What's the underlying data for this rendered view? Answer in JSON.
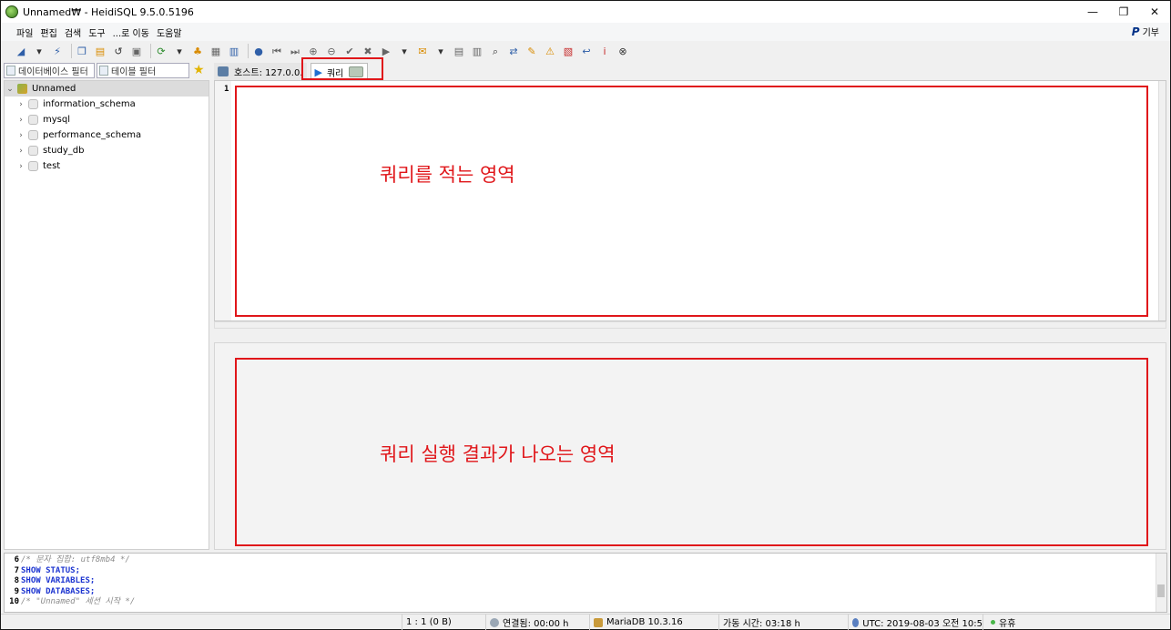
{
  "window": {
    "title": "Unnamed₩ - HeidiSQL 9.5.0.5196",
    "controls": [
      "—",
      "❐",
      "✕"
    ]
  },
  "menu": {
    "items": [
      "파일",
      "편집",
      "검색",
      "도구",
      "...로 이동",
      "도움말"
    ],
    "donate_label": "기부",
    "donate_logo": "P"
  },
  "toolbar": {
    "icons": [
      "connect-icon",
      "dropdown-icon",
      "disconnect-icon",
      "copy-icon",
      "paste-icon",
      "undo-icon",
      "print-icon",
      "refresh-icon",
      "dropdown-icon",
      "user-manager-icon",
      "export-icon",
      "import-icon",
      "help-icon",
      "first-icon",
      "last-icon",
      "add-icon",
      "remove-icon",
      "apply-icon",
      "cancel-icon",
      "run-icon",
      "dropdown-icon",
      "snippet-icon",
      "dropdown-icon",
      "save-icon",
      "save-as-icon",
      "find-icon",
      "replace-icon",
      "edit-icon",
      "warning-icon",
      "sql-icon",
      "wrap-icon",
      "info-icon",
      "stop-icon"
    ]
  },
  "filters": {
    "database_placeholder": "데이터베이스 필터",
    "table_placeholder": "테이블 필터"
  },
  "tree": {
    "root": "Unnamed",
    "databases": [
      "information_schema",
      "mysql",
      "performance_schema",
      "study_db",
      "test"
    ]
  },
  "tabs": {
    "host_label": "호스트: 127.0.0.",
    "query_label": "쿼리"
  },
  "editor": {
    "line_number": "1"
  },
  "annotations": {
    "query_area": "쿼리를 적는 영역",
    "result_area": "쿼리 실행 결과가 나오는 영역"
  },
  "log": [
    {
      "no": "6",
      "kind": "comment",
      "text": "/* 문자 집합: utf8mb4 */"
    },
    {
      "no": "7",
      "kind": "kw",
      "text": "SHOW STATUS;"
    },
    {
      "no": "8",
      "kind": "kw",
      "text": "SHOW VARIABLES;"
    },
    {
      "no": "9",
      "kind": "kw",
      "text": "SHOW DATABASES;"
    },
    {
      "no": "10",
      "kind": "comment",
      "text": "/* \"Unnamed\" 세션 시작 */"
    }
  ],
  "status": {
    "position": "1 : 1 (0 B)",
    "connected": "연결됨: 00:00 h",
    "server": "MariaDB 10.3.16",
    "uptime": "가동 시간: 03:18 h",
    "clock": "UTC: 2019-08-03 오전 10:5",
    "state": "유휴"
  },
  "colors": {
    "annotation": "#e0161a",
    "sql_keyword": "#1d35d0",
    "sql_comment": "#8c8c8c"
  }
}
